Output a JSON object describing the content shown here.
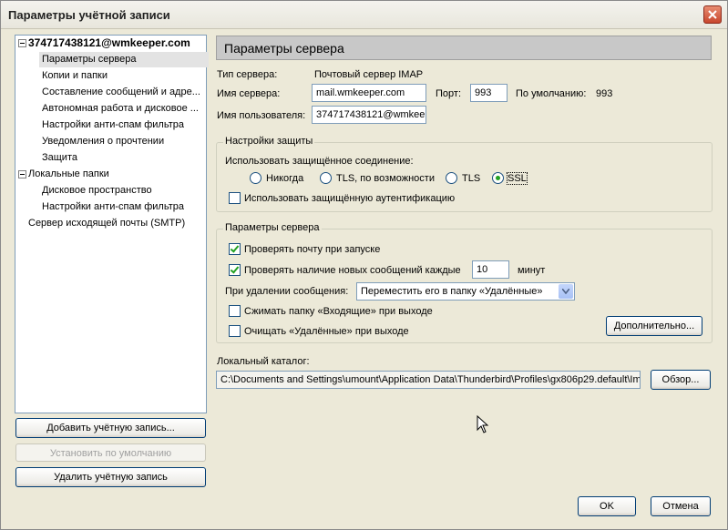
{
  "window": {
    "title": "Параметры учётной записи"
  },
  "tree": {
    "account": "374717438121@wmkeeper.com",
    "account_items": [
      "Параметры сервера",
      "Копии и папки",
      "Составление сообщений и адре...",
      "Автономная работа и дисковое ...",
      "Настройки анти-спам фильтра",
      "Уведомления о прочтении",
      "Защита"
    ],
    "local_folders": "Локальные папки",
    "local_items": [
      "Дисковое пространство",
      "Настройки анти-спам фильтра"
    ],
    "smtp": "Сервер исходящей почты (SMTP)"
  },
  "left_buttons": {
    "add_account": "Добавить учётную запись...",
    "set_default": "Установить по умолчанию",
    "delete_account": "Удалить учётную запись"
  },
  "panel": {
    "header": "Параметры сервера",
    "server_type_label": "Тип сервера:",
    "server_type_value": "Почтовый сервер IMAP",
    "server_name_label": "Имя сервера:",
    "server_name_value": "mail.wmkeeper.com",
    "port_label": "Порт:",
    "port_value": "993",
    "default_label": "По умолчанию:",
    "default_value": "993",
    "username_label": "Имя пользователя:",
    "username_value": "374717438121@wmkeep"
  },
  "security": {
    "title": "Настройки защиты",
    "use_secure_label": "Использовать защищённое соединение:",
    "options": [
      "Никогда",
      "TLS, по возможности",
      "TLS",
      "SSL"
    ],
    "selected": "SSL",
    "secure_auth_label": "Использовать защищённую аутентификацию",
    "secure_auth_checked": false
  },
  "server_settings": {
    "title": "Параметры сервера",
    "check_on_startup_label": "Проверять почту при запуске",
    "check_on_startup_checked": true,
    "check_every_label": "Проверять наличие новых сообщений каждые",
    "check_every_checked": true,
    "check_every_value": "10",
    "minutes_label": "минут",
    "on_delete_label": "При удалении сообщения:",
    "on_delete_value": "Переместить его в папку «Удалённые»",
    "compact_inbox_label": "Сжимать папку «Входящие» при выходе",
    "compact_inbox_checked": false,
    "empty_trash_label": "Очищать «Удалённые» при выходе",
    "empty_trash_checked": false,
    "advanced_button": "Дополнительно..."
  },
  "local_dir": {
    "label": "Локальный каталог:",
    "value": "C:\\Documents and Settings\\umount\\Application Data\\Thunderbird\\Profiles\\gx806p29.default\\Im",
    "browse_button": "Обзор..."
  },
  "dialog_buttons": {
    "ok": "OK",
    "cancel": "Отмена"
  },
  "colors": {
    "selection": "#e3e3e3",
    "header_bg": "#c8c8c8",
    "dialog_bg": "#ece9d8",
    "close_red": "#c8462d"
  }
}
